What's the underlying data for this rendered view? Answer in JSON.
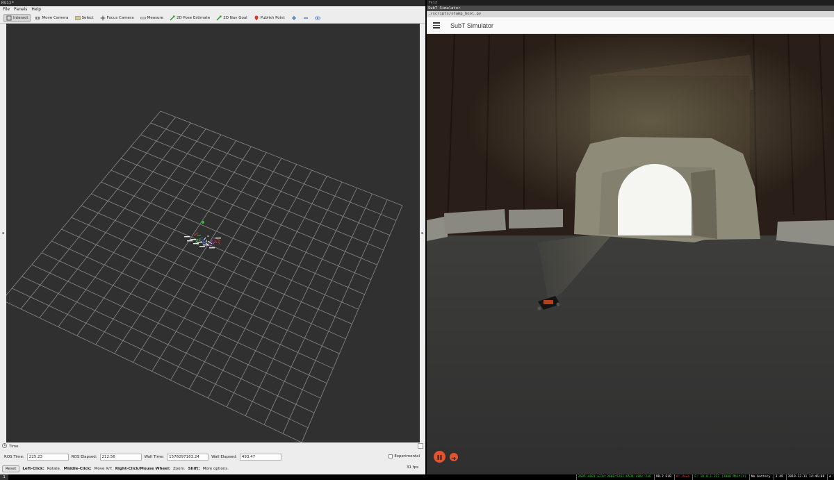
{
  "rviz": {
    "window_title": "RViz*",
    "menu": [
      "File",
      "Panels",
      "Help"
    ],
    "tools": [
      {
        "label": "Interact",
        "icon": "interact-icon",
        "active": true
      },
      {
        "label": "Move Camera",
        "icon": "move-camera-icon"
      },
      {
        "label": "Select",
        "icon": "select-icon"
      },
      {
        "label": "Focus Camera",
        "icon": "focus-camera-icon"
      },
      {
        "label": "Measure",
        "icon": "measure-icon"
      },
      {
        "label": "2D Pose Estimate",
        "icon": "pose-estimate-icon"
      },
      {
        "label": "2D Nav Goal",
        "icon": "nav-goal-icon"
      },
      {
        "label": "Publish Point",
        "icon": "publish-point-icon"
      }
    ],
    "time_panel_title": "Time",
    "ros_time_label": "ROS Time:",
    "ros_time": "225.23",
    "ros_elapsed_label": "ROS Elapsed:",
    "ros_elapsed": "212.56",
    "wall_time_label": "Wall Time:",
    "wall_time": "1576097163.24",
    "wall_elapsed_label": "Wall Elapsed:",
    "wall_elapsed": "493.47",
    "experimental_label": "Experimental",
    "reset_label": "Reset",
    "status_left_click": "Left-Click:",
    "status_left_action": "Rotate.",
    "status_middle_click": "Middle-Click:",
    "status_middle_action": "Move X/Y.",
    "status_right_click": "Right-Click/Mouse Wheel:",
    "status_right_action": "Zoom.",
    "status_shift": "Shift:",
    "status_shift_action": "More options.",
    "fps": "31 fps"
  },
  "sim": {
    "wm_title_1": "rviz",
    "wm_title_2": "SubT Simulator",
    "wm_path": "./scripts/stamp_bool.py",
    "app_title": "SubT Simulator",
    "colors": {
      "accent": "#e5532b",
      "app_bar": "#fafafa"
    }
  },
  "i3bar": {
    "workspace": "1",
    "segments": [
      {
        "text": "2605:e601:a23c:3600:5262:6534:c86c:2a6",
        "color": "#3c3"
      },
      {
        "text": "90.2 GiB",
        "color": "#fff"
      },
      {
        "text": "W: down",
        "color": "#e33"
      },
      {
        "text": "E: 10.0.1.222 (1000 Mbit/s)",
        "color": "#3c3"
      },
      {
        "text": "No battery",
        "color": "#fff"
      },
      {
        "text": "3.49",
        "color": "#fff"
      },
      {
        "text": "2019-12-11 14:46:08",
        "color": "#fff"
      }
    ]
  }
}
